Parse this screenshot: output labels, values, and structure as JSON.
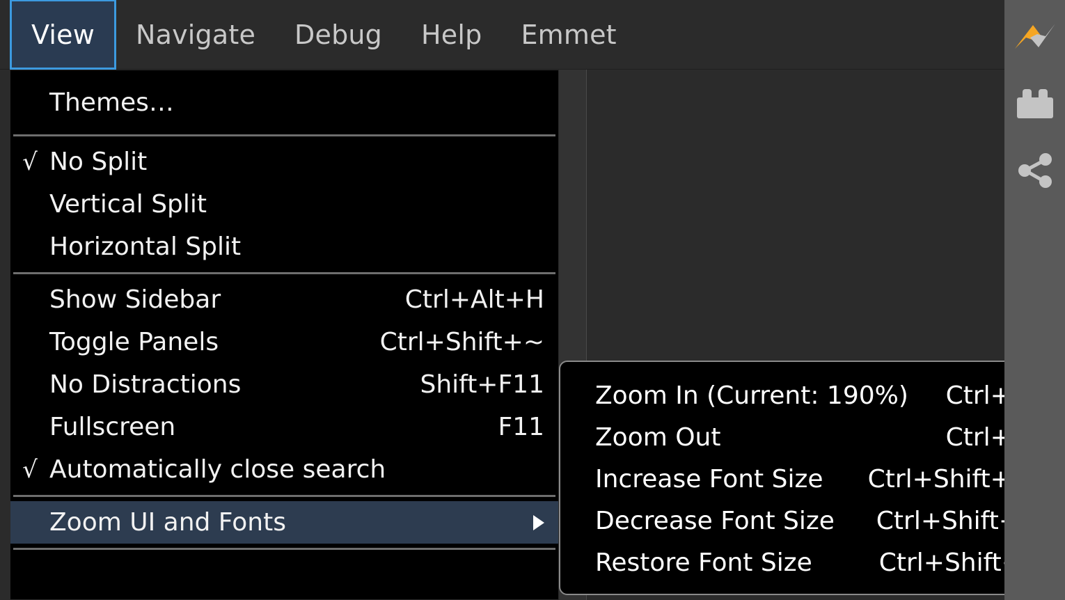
{
  "menubar": {
    "items": [
      {
        "label": "View",
        "active": true
      },
      {
        "label": "Navigate",
        "active": false
      },
      {
        "label": "Debug",
        "active": false
      },
      {
        "label": "Help",
        "active": false
      },
      {
        "label": "Emmet",
        "active": false
      }
    ]
  },
  "view_menu": {
    "sections": [
      {
        "items": [
          {
            "check": "",
            "label": "Themes…",
            "accel": "",
            "submenu": false,
            "selected": false
          }
        ]
      },
      {
        "items": [
          {
            "check": "√",
            "label": "No Split",
            "accel": "",
            "submenu": false,
            "selected": false
          },
          {
            "check": "",
            "label": "Vertical Split",
            "accel": "",
            "submenu": false,
            "selected": false
          },
          {
            "check": "",
            "label": "Horizontal Split",
            "accel": "",
            "submenu": false,
            "selected": false
          }
        ]
      },
      {
        "items": [
          {
            "check": "",
            "label": "Show Sidebar",
            "accel": "Ctrl+Alt+H",
            "submenu": false,
            "selected": false
          },
          {
            "check": "",
            "label": "Toggle Panels",
            "accel": "Ctrl+Shift+~",
            "submenu": false,
            "selected": false
          },
          {
            "check": "",
            "label": "No Distractions",
            "accel": "Shift+F11",
            "submenu": false,
            "selected": false
          },
          {
            "check": "",
            "label": "Fullscreen",
            "accel": "F11",
            "submenu": false,
            "selected": false
          },
          {
            "check": "√",
            "label": "Automatically close search",
            "accel": "",
            "submenu": false,
            "selected": false
          }
        ]
      },
      {
        "items": [
          {
            "check": "",
            "label": "Zoom UI and Fonts",
            "accel": "",
            "submenu": true,
            "selected": true
          }
        ]
      }
    ]
  },
  "zoom_submenu": {
    "items": [
      {
        "label": "Zoom In (Current: 190%)",
        "accel": "Ctrl++"
      },
      {
        "label": "Zoom Out",
        "accel": "Ctrl+−"
      },
      {
        "label": "Increase Font Size",
        "accel": "Ctrl+Shift++"
      },
      {
        "label": "Decrease Font Size",
        "accel": "Ctrl+Shift+_"
      },
      {
        "label": "Restore Font Size",
        "accel": "Ctrl+Shift+("
      }
    ]
  },
  "icon_rail": {
    "icons": [
      {
        "name": "emmet-logo-icon",
        "title": "Emmet"
      },
      {
        "name": "plugins-brick-icon",
        "title": "Plugins"
      },
      {
        "name": "share-node-icon",
        "title": "Share"
      }
    ]
  },
  "colors": {
    "menubar_bg": "#2b2b2b",
    "menu_bg": "#000000",
    "menu_selected_bg": "#2d3c50",
    "active_tab_bg": "#2a3b52",
    "active_tab_border": "#3c9ae0",
    "separator": "#6e6e6e",
    "text": "#f2f2f2",
    "menubar_text": "#c8c8c8",
    "rail_bg": "#5a5a5a",
    "emmet_orange": "#f5a623",
    "emmet_gray": "#c4c4c4",
    "gutter_bg": "#333333"
  }
}
